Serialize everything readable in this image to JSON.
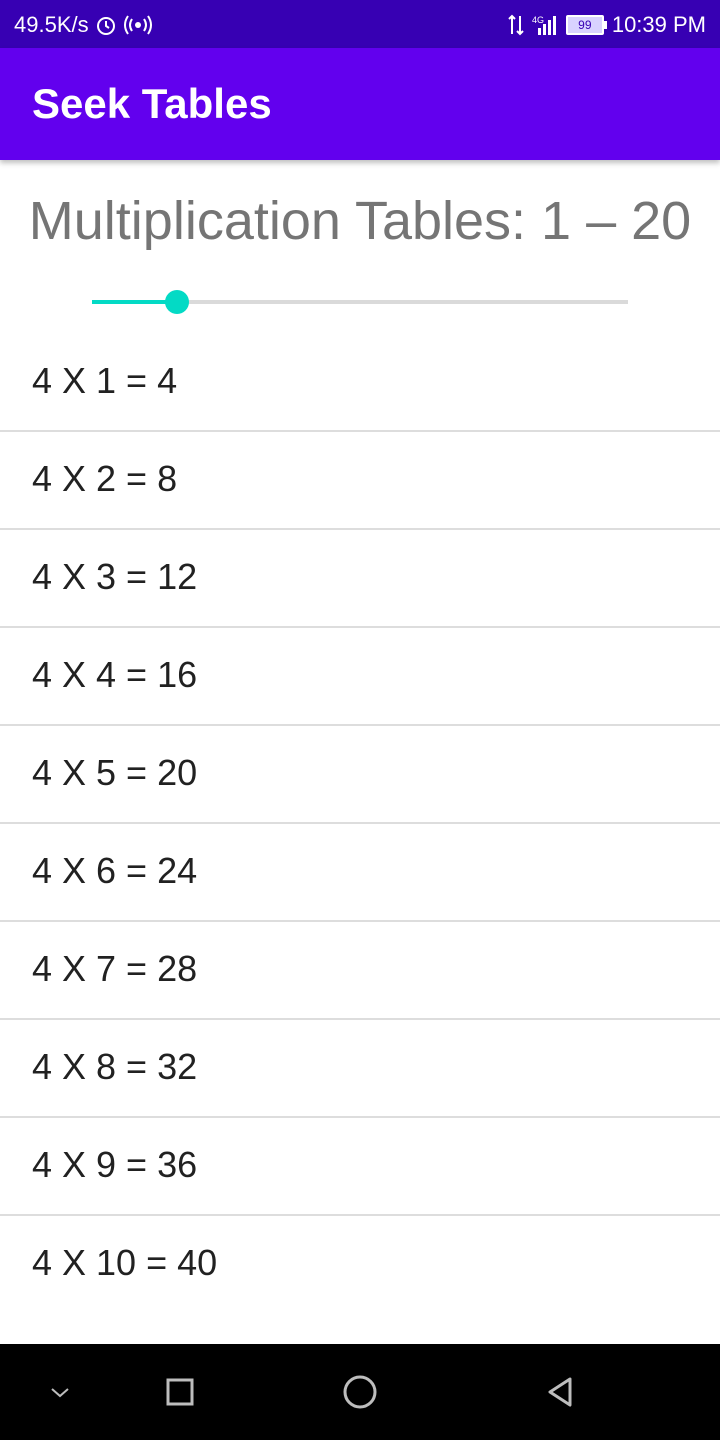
{
  "status_bar": {
    "speed": "49.5K/s",
    "network_4g": "4G",
    "battery": "99",
    "time": "10:39 PM",
    "icons": [
      "alarm-icon",
      "hotspot-icon",
      "data-arrows-icon",
      "signal-icon",
      "battery-icon"
    ]
  },
  "app_bar": {
    "title": "Seek Tables",
    "color": "#6200ee"
  },
  "heading": "Multiplication Tables: 1 – 20",
  "slider": {
    "min": 1,
    "max": 20,
    "value": 4,
    "accent": "#03dac5"
  },
  "table": {
    "rows": [
      "4 X 1 = 4",
      "4 X 2 = 8",
      "4 X 3 = 12",
      "4 X 4 = 16",
      "4 X 5 = 20",
      "4 X 6 = 24",
      "4 X 7 = 28",
      "4 X 8 = 32",
      "4 X 9 = 36",
      "4 X 10 = 40"
    ]
  },
  "nav_bar": {
    "buttons": [
      "chevron-down-icon",
      "recents-square-icon",
      "home-circle-icon",
      "back-triangle-icon"
    ]
  }
}
